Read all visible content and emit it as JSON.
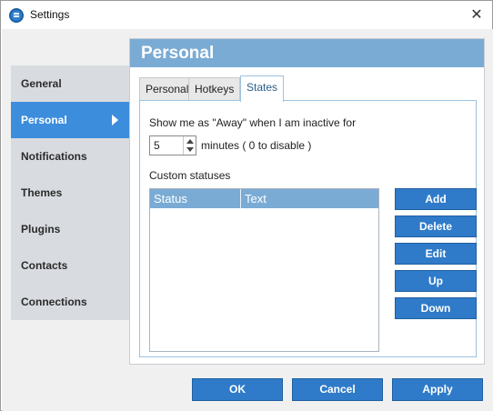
{
  "window": {
    "title": "Settings",
    "close_glyph": "✕"
  },
  "sidebar": {
    "items": [
      {
        "label": "General"
      },
      {
        "label": "Personal"
      },
      {
        "label": "Notifications"
      },
      {
        "label": "Themes"
      },
      {
        "label": "Plugins"
      },
      {
        "label": "Contacts"
      },
      {
        "label": "Connections"
      }
    ],
    "active_index": 1
  },
  "panel": {
    "title": "Personal"
  },
  "tabs": [
    {
      "label": "Personal"
    },
    {
      "label": "Hotkeys"
    },
    {
      "label": "States"
    }
  ],
  "states": {
    "away_label": "Show me as \"Away\" when I am inactive for",
    "away_minutes": "5",
    "minutes_suffix": "minutes ( 0 to disable )",
    "custom_statuses_label": "Custom statuses",
    "table": {
      "columns": [
        "Status",
        "Text"
      ],
      "rows": []
    },
    "buttons": {
      "add": "Add",
      "delete": "Delete",
      "edit": "Edit",
      "up": "Up",
      "down": "Down"
    }
  },
  "footer": {
    "ok": "OK",
    "cancel": "Cancel",
    "apply": "Apply"
  },
  "colors": {
    "accent": "#2f7bc9",
    "sidebar_active": "#3d8ddd",
    "header": "#7aabd4",
    "sidebar_bg": "#d8dbe0"
  },
  "icons": {
    "app": "app-icon",
    "close": "close-icon",
    "active_arrow": "chevron-right-icon"
  }
}
